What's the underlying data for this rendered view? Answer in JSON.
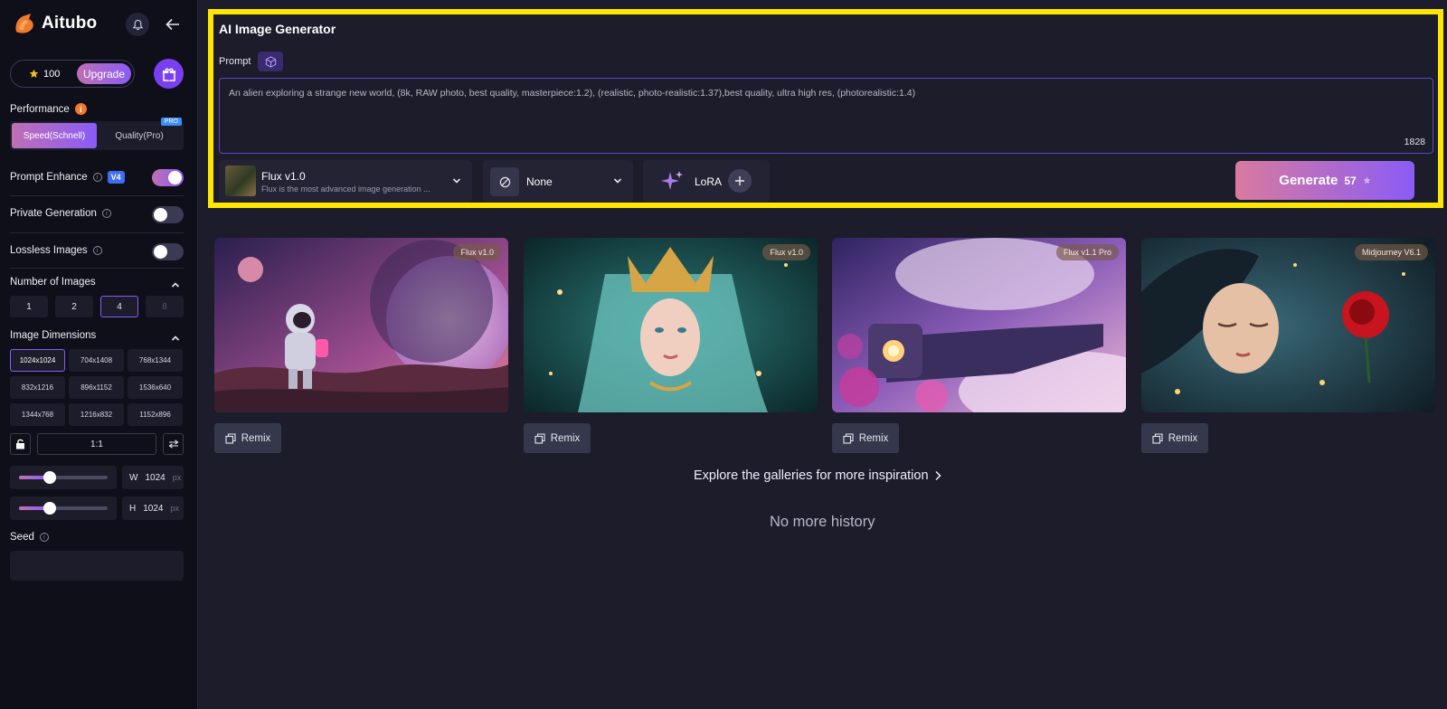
{
  "app": {
    "name": "Aitubo"
  },
  "credits": {
    "value": "100",
    "upgrade_label": "Upgrade"
  },
  "performance": {
    "label": "Performance",
    "speed_label": "Speed(Schnell)",
    "quality_label": "Quality(Pro)",
    "pro_tag": "PRO"
  },
  "toggles": {
    "prompt_enhance": {
      "label": "Prompt Enhance",
      "badge": "V4",
      "on": true
    },
    "private_generation": {
      "label": "Private Generation",
      "on": false
    },
    "lossless_images": {
      "label": "Lossless Images",
      "on": false
    }
  },
  "num_images": {
    "label": "Number of Images",
    "options": [
      "1",
      "2",
      "4",
      "8"
    ],
    "selected": "4"
  },
  "dimensions": {
    "label": "Image Dimensions",
    "options": [
      "1024x1024",
      "704x1408",
      "768x1344",
      "832x1216",
      "896x1152",
      "1536x640",
      "1344x768",
      "1216x832",
      "1152x896"
    ],
    "selected": "1024x1024",
    "ratio": "1:1",
    "width": {
      "prefix": "W",
      "value": "1024",
      "unit": "px",
      "fraction": 0.35
    },
    "height": {
      "prefix": "H",
      "value": "1024",
      "unit": "px",
      "fraction": 0.35
    }
  },
  "seed": {
    "label": "Seed",
    "value": ""
  },
  "generator": {
    "title": "AI Image Generator",
    "prompt_label": "Prompt",
    "prompt_text": "An alien exploring a strange new world, (8k, RAW photo, best quality, masterpiece:1.2), (realistic, photo-realistic:1.37),best quality, ultra high res, (photorealistic:1.4)",
    "char_count": "1828",
    "model": {
      "name": "Flux v1.0",
      "desc": "Flux is the most advanced image generation ..."
    },
    "style": {
      "name": "None"
    },
    "lora": {
      "name": "LoRA"
    },
    "generate": {
      "label": "Generate",
      "cost": "57"
    }
  },
  "gallery": [
    {
      "tag": "Flux v1.0",
      "remix_label": "Remix"
    },
    {
      "tag": "Flux v1.0",
      "remix_label": "Remix"
    },
    {
      "tag": "Flux v1.1 Pro",
      "remix_label": "Remix"
    },
    {
      "tag": "Midjourney V6.1",
      "remix_label": "Remix"
    }
  ],
  "explore_label": "Explore the galleries for more inspiration",
  "no_more_label": "No more history",
  "colors": {
    "accent": "#8a5cf6",
    "pink": "#c06fb4",
    "highlight": "#ffe600",
    "bg": "#1c1c2b"
  }
}
